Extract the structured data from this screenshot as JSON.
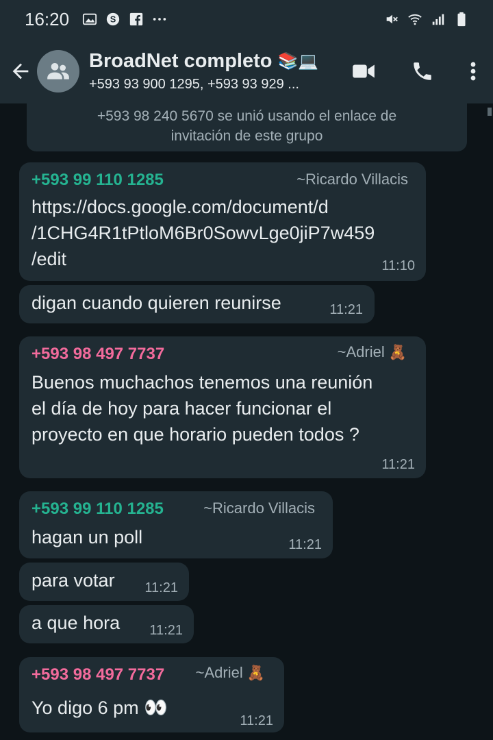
{
  "status": {
    "time": "16:20"
  },
  "header": {
    "title": "BroadNet completo",
    "title_emoji": "📚💻",
    "subtitle": "+593 93 900 1295, +593 93 929 ..."
  },
  "system_message": {
    "line1": "+593 98 240 5670 se unió usando el enlace de",
    "line2": "invitación de este grupo"
  },
  "messages": [
    {
      "sender_number": "+593 99 110 1285",
      "sender_name": "~Ricardo Villacis",
      "lines": [
        "https://docs.google.com/document/d",
        "/1CHG4R1tPtloM6Br0SowvLge0jiP7w459",
        "/edit"
      ],
      "time": "11:10"
    },
    {
      "lines": [
        "digan cuando quieren reunirse"
      ],
      "time": "11:21"
    },
    {
      "sender_number": "+593 98 497 7737",
      "sender_name": "~Adriel",
      "sender_emoji": "🧸",
      "lines": [
        "Buenos muchachos tenemos una reunión",
        "el día de hoy para hacer funcionar el",
        "proyecto en que horario pueden todos ?"
      ],
      "time": "11:21"
    },
    {
      "sender_number": "+593 99 110 1285",
      "sender_name": "~Ricardo Villacis",
      "lines": [
        "hagan un poll"
      ],
      "time": "11:21"
    },
    {
      "lines": [
        "para votar"
      ],
      "time": "11:21"
    },
    {
      "lines": [
        "a que hora"
      ],
      "time": "11:21"
    },
    {
      "sender_number": "+593 98 497 7737",
      "sender_name": "~Adriel",
      "sender_emoji": "🧸",
      "lines": [
        "Yo digo 6 pm"
      ],
      "text_emoji": "👀",
      "time": "11:21"
    }
  ],
  "colors": {
    "bar_bg": "#1f2c33",
    "chat_bg": "#0d1418",
    "bubble_bg": "#1f2c33",
    "green_sender": "#25b391",
    "pink_sender": "#f26b9c",
    "link": "#53bdeb"
  }
}
